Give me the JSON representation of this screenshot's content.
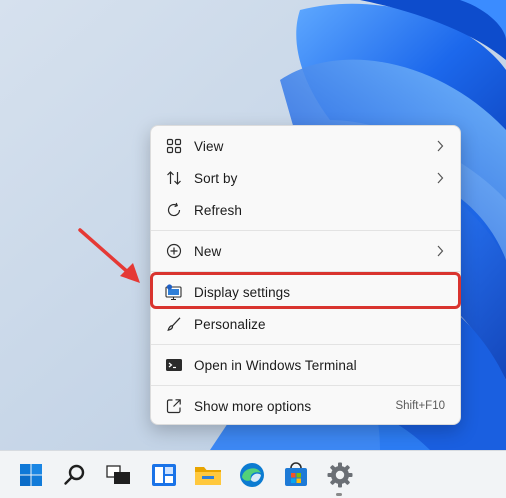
{
  "context_menu": {
    "items": [
      {
        "label": "View",
        "icon": "view-grid-icon",
        "has_submenu": true
      },
      {
        "label": "Sort by",
        "icon": "sort-arrows-icon",
        "has_submenu": true
      },
      {
        "label": "Refresh",
        "icon": "refresh-icon",
        "has_submenu": false
      },
      {
        "label": "New",
        "icon": "plus-circle-icon",
        "has_submenu": true
      },
      {
        "label": "Display settings",
        "icon": "display-monitor-icon",
        "has_submenu": false,
        "highlighted": true
      },
      {
        "label": "Personalize",
        "icon": "paintbrush-icon",
        "has_submenu": false
      },
      {
        "label": "Open in Windows Terminal",
        "icon": "terminal-icon",
        "has_submenu": false
      },
      {
        "label": "Show more options",
        "icon": "share-expand-icon",
        "has_submenu": false,
        "shortcut": "Shift+F10"
      }
    ]
  },
  "annotation": {
    "highlight_color": "#d9342f",
    "arrow_color": "#e53935"
  },
  "taskbar": {
    "icons": [
      "windows-start-icon",
      "search-icon",
      "task-view-icon",
      "widgets-icon",
      "file-explorer-icon",
      "edge-browser-icon",
      "microsoft-store-icon",
      "settings-gear-icon"
    ]
  },
  "colors": {
    "accent": "#0067c0",
    "wallpaper_blue": "#1f6fe6"
  }
}
